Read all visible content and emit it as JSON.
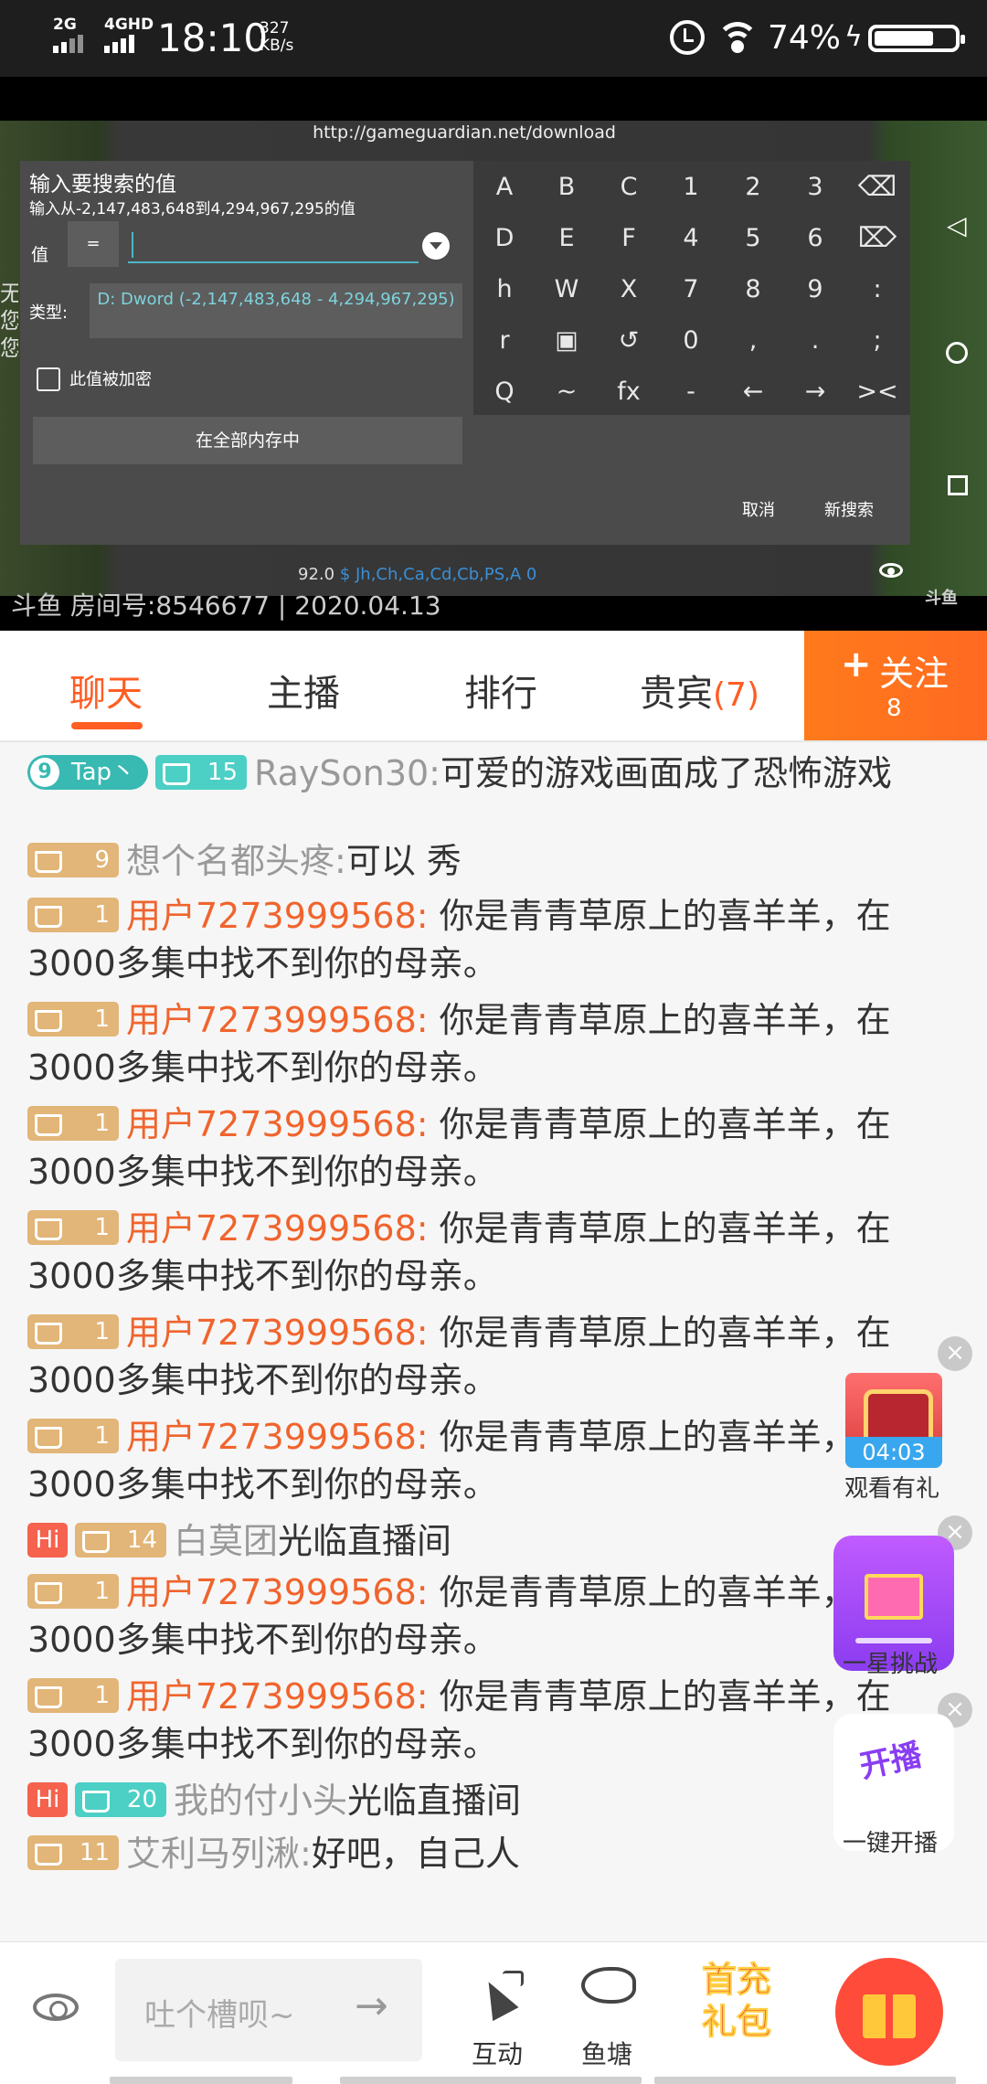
{
  "status_bar": {
    "network1": "2G",
    "network2": "4GHD",
    "time": "18:10",
    "speed_value": "327",
    "speed_unit": "KB/s",
    "battery_pct": "74%",
    "battery_level": 0.74,
    "icons": [
      "signal-icon",
      "alarm-icon",
      "wifi-icon",
      "charging-icon",
      "battery-icon"
    ]
  },
  "video": {
    "url": "http://gameguardian.net/download",
    "dialog_title": "输入要搜索的值",
    "dialog_subtitle": "输入从-2,147,483,648到4,294,967,295的值",
    "value_label": "值",
    "equals_button": "=",
    "type_label": "类型:",
    "type_value": "D: Dword (-2,147,483,648 - 4,294,967,295)",
    "encrypted_label": "此值被加密",
    "memory_button": "在全部内存中",
    "cancel_button": "取消",
    "new_search_button": "新搜索",
    "stats": "92.0",
    "stats_colored": "$ Jh,Ch,Ca,Cd,Cb,PS,A 0",
    "room_text": "斗鱼 房间号:8546677 | 2020.04.13",
    "logo_text": "斗鱼",
    "keyboard": [
      [
        "A",
        "B",
        "C",
        "1",
        "2",
        "3",
        "⌫"
      ],
      [
        "D",
        "E",
        "F",
        "4",
        "5",
        "6",
        "⌦"
      ],
      [
        "h",
        "W",
        "X",
        "7",
        "8",
        "9",
        ":"
      ],
      [
        "r",
        "▣",
        "↺",
        "0",
        ",",
        ".",
        ";"
      ],
      [
        "Q",
        "~",
        "fx",
        "-",
        "←",
        "→",
        "><"
      ]
    ],
    "side_text": "无您您"
  },
  "tabs": {
    "items": [
      {
        "label": "聊天"
      },
      {
        "label": "主播"
      },
      {
        "label": "排行"
      },
      {
        "label": "贵宾"
      }
    ],
    "vip_count": "(7)",
    "active_index": 0,
    "follow_label": "关注",
    "follow_plus": "+",
    "follow_count": "8"
  },
  "chat": {
    "messages": [
      {
        "badges": [
          "9",
          "Tap丶",
          "15"
        ],
        "nick": "RaySon30:",
        "text": "可爱的游戏画面成了恐怖游戏"
      },
      {
        "badges": [
          "9"
        ],
        "nick": "想个名都头疼:",
        "text": "可以 秀"
      },
      {
        "badges": [
          "1"
        ],
        "nick": "用户7273999568:",
        "text": " 你是青青草原上的喜羊羊，在3000多集中找不到你的母亲。"
      },
      {
        "badges": [
          "1"
        ],
        "nick": "用户7273999568:",
        "text": " 你是青青草原上的喜羊羊，在3000多集中找不到你的母亲。"
      },
      {
        "badges": [
          "1"
        ],
        "nick": "用户7273999568:",
        "text": " 你是青青草原上的喜羊羊，在3000多集中找不到你的母亲。"
      },
      {
        "badges": [
          "1"
        ],
        "nick": "用户7273999568:",
        "text": " 你是青青草原上的喜羊羊，在3000多集中找不到你的母亲。"
      },
      {
        "badges": [
          "1"
        ],
        "nick": "用户7273999568:",
        "text": " 你是青青草原上的喜羊羊，在3000多集中找不到你的母亲。"
      },
      {
        "badges": [
          "1"
        ],
        "nick": "用户7273999568:",
        "text": " 你是青青草原上的喜羊羊，在3000多集中找不到你的母亲。"
      },
      {
        "badges": [
          "Hi",
          "14"
        ],
        "nick": "白莫团",
        "text": "光临直播间"
      },
      {
        "badges": [
          "1"
        ],
        "nick": "用户7273999568:",
        "text": " 你是青青草原上的喜羊羊，在3000多集中找不到你的母亲。"
      },
      {
        "badges": [
          "1"
        ],
        "nick": "用户7273999568:",
        "text": " 你是青青草原上的喜羊羊，在3000多集中找不到你的母亲。"
      },
      {
        "badges": [
          "Hi",
          "20"
        ],
        "nick": "我的付小头",
        "text": "光临直播间"
      },
      {
        "badges": [
          "11"
        ],
        "nick": "艾利马列湫:",
        "text": "好吧，自己人"
      }
    ]
  },
  "floaters": {
    "close": "×",
    "chest_timer": "04:03",
    "chest_caption": "观看有礼",
    "challenge_caption": "一星挑战",
    "live_caption": "一键开播"
  },
  "bottom_bar": {
    "input_placeholder": "吐个槽呗~",
    "send_arrow": "→",
    "interact_label": "互动",
    "fishpond_label": "鱼塘",
    "promo_line1": "首充",
    "promo_line2": "礼包"
  }
}
